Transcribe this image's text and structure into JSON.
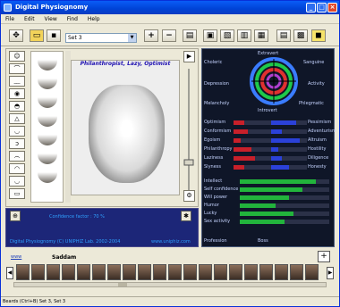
{
  "window": {
    "title": "Digital Physiognomy",
    "minimize": "_",
    "maximize": "□",
    "close": "×"
  },
  "menu": [
    "File",
    "Edit",
    "View",
    "Find",
    "Help"
  ],
  "toolbar": {
    "combo_value": "Set 3",
    "plus": "+",
    "minus": "−"
  },
  "face": {
    "title": "Philanthropist, Lazy, Optimist"
  },
  "midbar": {
    "confidence": "Confidence factor :  70   %",
    "copyright": "Digital Physiognomy (C) UNIPHIZ Lab. 2002-2004",
    "url": "www.uniphiz.com"
  },
  "temperament": {
    "top": "Extravert",
    "bottom": "Introvert",
    "left_top": "Choleric",
    "right_top": "Sanguine",
    "left_mid": "Depression",
    "right_mid": "Activity",
    "left_bot": "Melancholy",
    "right_bot": "Phlegmatic"
  },
  "traits": [
    {
      "left": "Optimism",
      "right": "Pessimism",
      "red": 0.3,
      "blue": 0.7
    },
    {
      "left": "Conformism",
      "right": "Adventurism",
      "red": 0.4,
      "blue": 0.3
    },
    {
      "left": "Egoism",
      "right": "Altruism",
      "red": 0.2,
      "blue": 0.8
    },
    {
      "left": "Philanthropy",
      "right": "Hostility",
      "red": 0.5,
      "blue": 0.2
    },
    {
      "left": "Laziness",
      "right": "Diligence",
      "red": 0.6,
      "blue": 0.3
    },
    {
      "left": "Slyness",
      "right": "Honesty",
      "red": 0.3,
      "blue": 0.5
    }
  ],
  "abilities": [
    {
      "label": "Intellect",
      "value": 0.85
    },
    {
      "label": "Self confidence",
      "value": 0.7
    },
    {
      "label": "Will power",
      "value": 0.55
    },
    {
      "label": "Humor",
      "value": 0.4
    },
    {
      "label": "Lucky",
      "value": 0.6
    },
    {
      "label": "Sex activity",
      "value": 0.5
    }
  ],
  "profession": {
    "label": "Profession",
    "value": "Boss"
  },
  "strip": {
    "link": "www",
    "name": "Saddam",
    "add": "+"
  },
  "status": "Beards (Ctrl+B)  Set  3,  Set  3"
}
